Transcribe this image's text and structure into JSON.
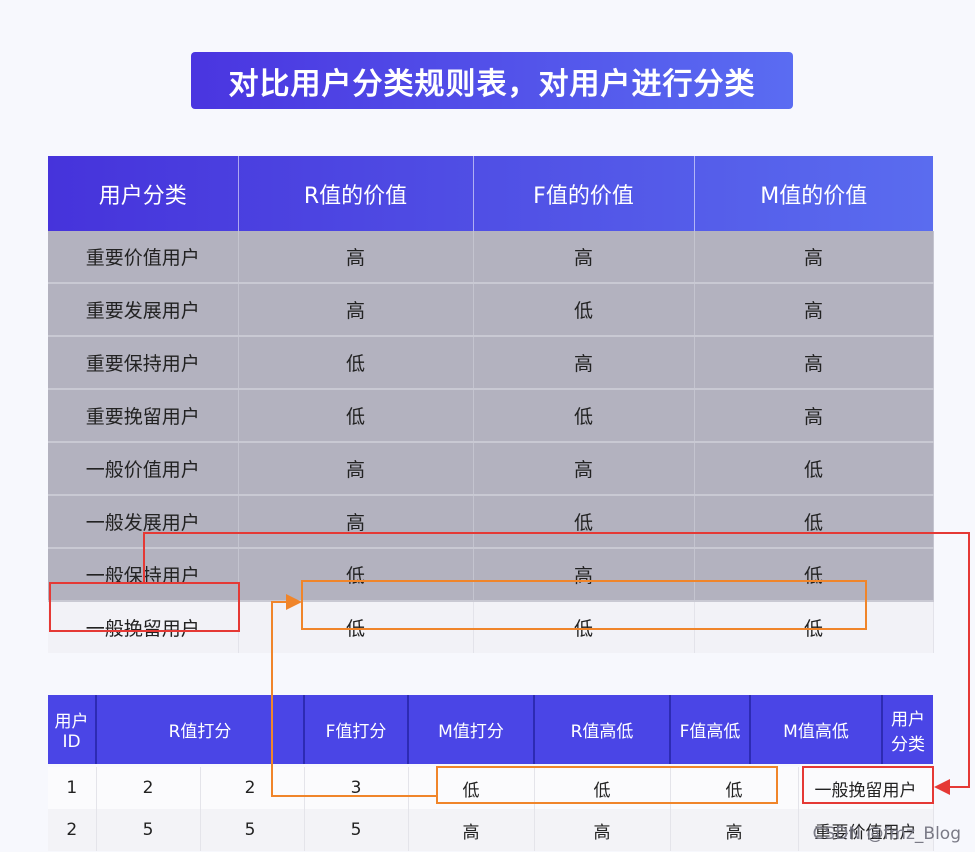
{
  "banner_title": "对比用户分类规则表，对用户进行分类",
  "rules_table": {
    "headers": [
      "用户分类",
      "R值的价值",
      "F值的价值",
      "M值的价值"
    ],
    "rows": [
      [
        "重要价值用户",
        "高",
        "高",
        "高"
      ],
      [
        "重要发展用户",
        "高",
        "低",
        "高"
      ],
      [
        "重要保持用户",
        "低",
        "高",
        "高"
      ],
      [
        "重要挽留用户",
        "低",
        "低",
        "高"
      ],
      [
        "一般价值用户",
        "高",
        "高",
        "低"
      ],
      [
        "一般发展用户",
        "高",
        "低",
        "低"
      ],
      [
        "一般保持用户",
        "低",
        "高",
        "低"
      ],
      [
        "一般挽留用户",
        "低",
        "低",
        "低"
      ]
    ]
  },
  "users_table": {
    "headers": [
      "用户ID",
      "R值打分",
      "F值打分",
      "M值打分",
      "R值高低",
      "F值高低",
      "M值高低",
      "用户分类"
    ],
    "rows": [
      [
        "1",
        "2",
        "2",
        "3",
        "低",
        "低",
        "低",
        "一般挽留用户"
      ],
      [
        "2",
        "5",
        "5",
        "5",
        "高",
        "高",
        "高",
        "重要价值用户"
      ]
    ]
  },
  "colors": {
    "red_highlight": "#e53935",
    "orange_highlight": "#f0852a",
    "header_blue": "#4a45e6"
  },
  "watermark": "CSDN @fmz_Blog"
}
